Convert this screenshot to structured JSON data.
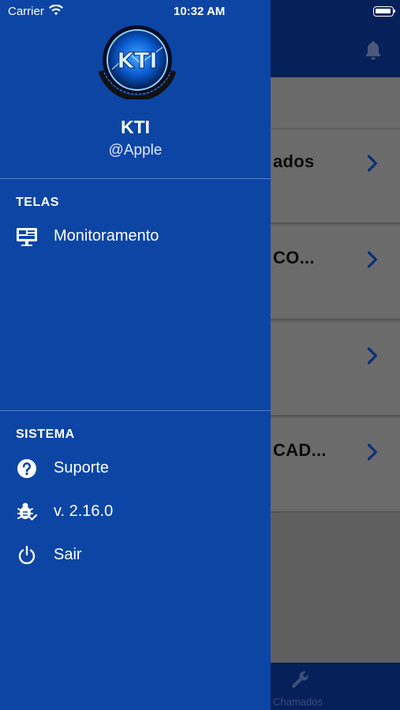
{
  "status_bar": {
    "carrier": "Carrier",
    "time": "10:32 AM"
  },
  "profile": {
    "name": "KTI",
    "handle": "@Apple",
    "logo_text": "KTI"
  },
  "sections": [
    {
      "title": "TELAS",
      "items": [
        {
          "label": "Monitoramento",
          "icon": "monitor-icon"
        }
      ]
    },
    {
      "title": "SISTEMA",
      "items": [
        {
          "label": "Suporte",
          "icon": "help-icon"
        },
        {
          "label": "v. 2.16.0",
          "icon": "bug-check-icon"
        },
        {
          "label": "Sair",
          "icon": "power-icon"
        }
      ]
    }
  ],
  "background": {
    "cards": [
      {
        "text": "ados"
      },
      {
        "text": "CO..."
      },
      {
        "text": ""
      },
      {
        "text": "CAD..."
      }
    ],
    "tab_label": "Chamados"
  },
  "colors": {
    "drawer": "#0c45a4",
    "header": "#06205a",
    "overlay": "#5f5f5f",
    "text": "#ffffff"
  }
}
